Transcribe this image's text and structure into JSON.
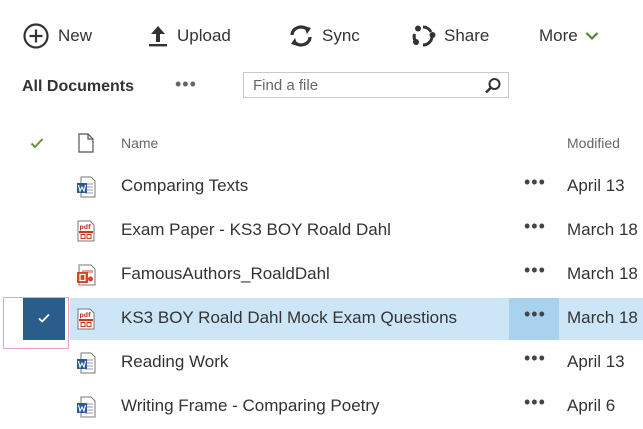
{
  "toolbar": {
    "new_label": "New",
    "upload_label": "Upload",
    "sync_label": "Sync",
    "share_label": "Share",
    "more_label": "More"
  },
  "view": {
    "title": "All Documents",
    "dots": "•••",
    "search_placeholder": "Find a file"
  },
  "columns": {
    "name": "Name",
    "modified": "Modified"
  },
  "files": [
    {
      "name": "Comparing Texts",
      "modified": "April 13",
      "type": "word-icon",
      "selected": false
    },
    {
      "name": "Exam Paper - KS3 BOY Roald Dahl",
      "modified": "March 18",
      "type": "pdf-icon",
      "selected": false
    },
    {
      "name": "FamousAuthors_RoaldDahl",
      "modified": "March 18",
      "type": "powerpoint-icon",
      "selected": false
    },
    {
      "name": "KS3 BOY Roald Dahl Mock Exam Questions",
      "modified": "March 18",
      "type": "pdf-icon",
      "selected": true
    },
    {
      "name": "Reading Work",
      "modified": "April 13",
      "type": "word-icon",
      "selected": false
    },
    {
      "name": "Writing Frame - Comparing Poetry",
      "modified": "April 6",
      "type": "word-icon",
      "selected": false
    }
  ],
  "colors": {
    "accent": "#2b5d8c",
    "selected_row": "#cde6f7",
    "selected_more": "#a9d2ee",
    "check_green": "#6a8e3a",
    "word_blue": "#2b579a",
    "pdf_red": "#c0392b",
    "ppt_orange": "#d24726"
  }
}
